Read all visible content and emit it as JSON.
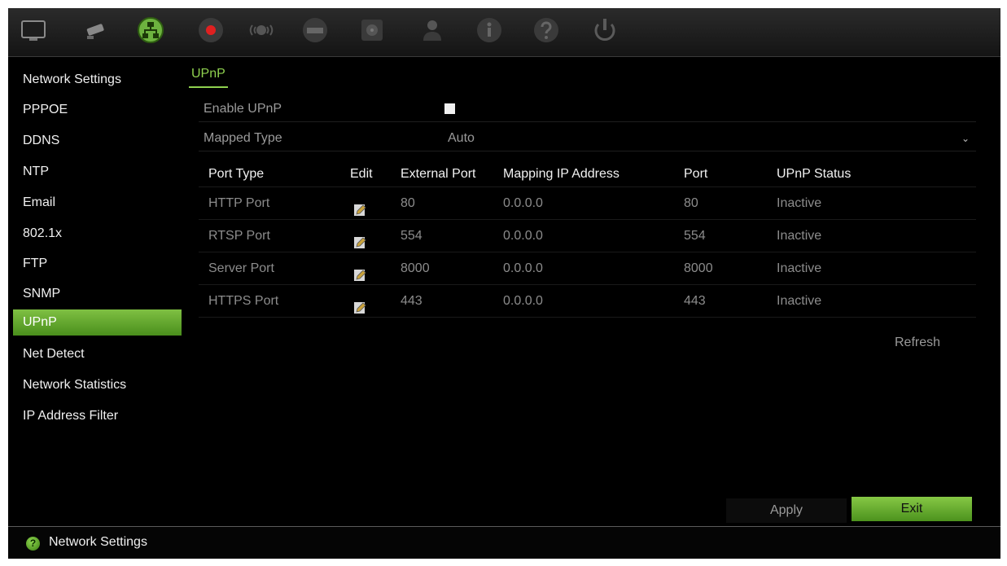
{
  "toolbar": {
    "icons": [
      {
        "name": "display-icon"
      },
      {
        "name": "camera-icon"
      },
      {
        "name": "network-icon",
        "active": true
      },
      {
        "name": "record-icon"
      },
      {
        "name": "alarm-icon"
      },
      {
        "name": "device-icon"
      },
      {
        "name": "storage-icon"
      },
      {
        "name": "user-icon"
      },
      {
        "name": "info-icon"
      },
      {
        "name": "help-icon"
      },
      {
        "name": "power-icon"
      }
    ]
  },
  "sidebar": {
    "items": [
      {
        "label": "Network Settings"
      },
      {
        "label": "PPPOE"
      },
      {
        "label": "DDNS"
      },
      {
        "label": "NTP"
      },
      {
        "label": "Email"
      },
      {
        "label": "802.1x"
      },
      {
        "label": "FTP"
      },
      {
        "label": "SNMP"
      },
      {
        "label": "UPnP",
        "active": true
      },
      {
        "label": "Net Detect"
      },
      {
        "label": "Network Statistics"
      },
      {
        "label": "IP Address Filter"
      }
    ]
  },
  "main": {
    "tab": "UPnP",
    "enable_label": "Enable UPnP",
    "enable_checked": false,
    "mapped_type_label": "Mapped Type",
    "mapped_type_value": "Auto",
    "table": {
      "headers": [
        "Port Type",
        "Edit",
        "External Port",
        "Mapping IP Address",
        "Port",
        "UPnP Status"
      ],
      "rows": [
        {
          "port_type": "HTTP Port",
          "external_port": "80",
          "mapping_ip": "0.0.0.0",
          "port": "80",
          "status": "Inactive"
        },
        {
          "port_type": "RTSP Port",
          "external_port": "554",
          "mapping_ip": "0.0.0.0",
          "port": "554",
          "status": "Inactive"
        },
        {
          "port_type": "Server Port",
          "external_port": "8000",
          "mapping_ip": "0.0.0.0",
          "port": "8000",
          "status": "Inactive"
        },
        {
          "port_type": "HTTPS Port",
          "external_port": "443",
          "mapping_ip": "0.0.0.0",
          "port": "443",
          "status": "Inactive"
        }
      ]
    },
    "refresh_label": "Refresh",
    "apply_label": "Apply",
    "exit_label": "Exit"
  },
  "statusbar": {
    "text": "Network Settings"
  },
  "colors": {
    "accent": "#7fc043",
    "background": "#000000"
  }
}
